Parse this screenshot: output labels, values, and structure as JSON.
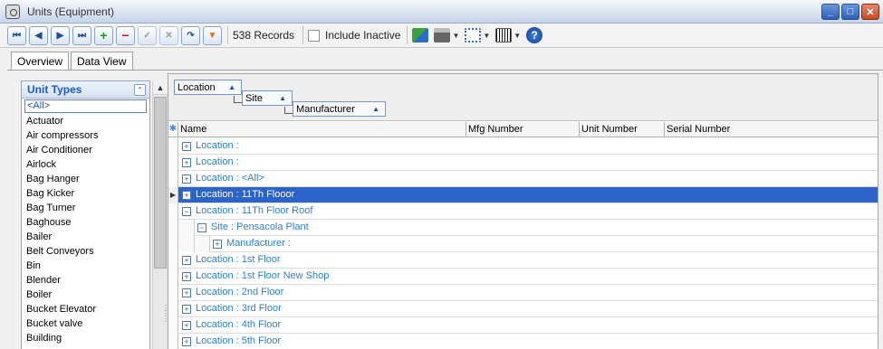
{
  "window": {
    "title": "Units (Equipment)"
  },
  "toolbar": {
    "records_text": "538 Records",
    "include_inactive_label": "Include Inactive"
  },
  "tabs": [
    {
      "label": "Overview"
    },
    {
      "label": "Data View"
    }
  ],
  "unit_types": {
    "title": "Unit Types",
    "items": [
      "<All>",
      "Actuator",
      "Air compressors",
      "Air Conditioner",
      "Airlock",
      "Bag Hanger",
      "Bag Kicker",
      "Bag Turner",
      "Baghouse",
      "Bailer",
      "Belt Conveyors",
      "Bin",
      "Blender",
      "Boiler",
      "Bucket Elevator",
      "Bucket valve",
      "Building"
    ]
  },
  "grouping": {
    "chips": [
      "Location",
      "Site",
      "Manufacturer"
    ]
  },
  "grid": {
    "columns": [
      "Name",
      "Mfg Number",
      "Unit Number",
      "Serial Number"
    ],
    "rows": [
      {
        "text": "Location :",
        "level": 0,
        "expander": "+"
      },
      {
        "text": "Location :",
        "level": 0,
        "expander": "+"
      },
      {
        "text": "Location : <All>",
        "level": 0,
        "expander": "+"
      },
      {
        "text": "Location : 11Th Flooor",
        "level": 0,
        "expander": "+",
        "selected": true
      },
      {
        "text": "Location : 11Th Floor Roof",
        "level": 0,
        "expander": "−"
      },
      {
        "text": "Site : Pensacola Plant",
        "level": 1,
        "expander": "−"
      },
      {
        "text": "Manufacturer :",
        "level": 2,
        "expander": "+"
      },
      {
        "text": "Location : 1st Floor",
        "level": 0,
        "expander": "+"
      },
      {
        "text": "Location : 1st Floor New Shop",
        "level": 0,
        "expander": "+"
      },
      {
        "text": "Location : 2nd Floor",
        "level": 0,
        "expander": "+"
      },
      {
        "text": "Location : 3rd Floor",
        "level": 0,
        "expander": "+"
      },
      {
        "text": "Location : 4th Floor",
        "level": 0,
        "expander": "+"
      },
      {
        "text": "Location : 5th Floor",
        "level": 0,
        "expander": "+"
      }
    ]
  }
}
